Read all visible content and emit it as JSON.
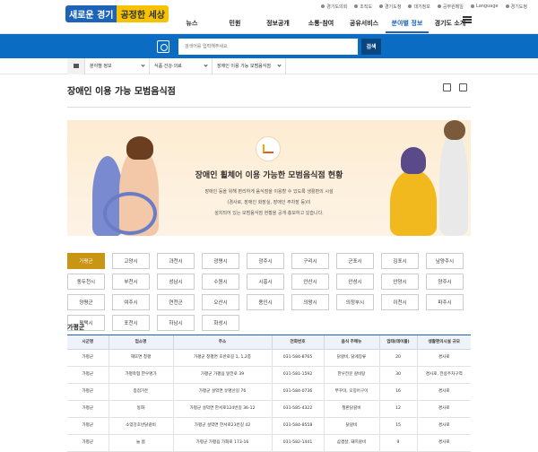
{
  "topbar": {
    "links": [
      "경기도의회",
      "조직도",
      "경기도청",
      "대기정보",
      "공무원메일",
      "Language",
      "경기도청"
    ]
  },
  "logo": {
    "part1": "새로운 경기",
    "part2": "공정한 세상"
  },
  "gnb": {
    "items": [
      "뉴스",
      "민원",
      "정보공개",
      "소통·참여",
      "공유서비스",
      "분야별 정보",
      "경기도 소개"
    ],
    "active_index": 5
  },
  "search": {
    "placeholder": "검색어를 입력해주세요",
    "button": "검색"
  },
  "breadcrumb": {
    "items": [
      "분야별 정보",
      "식품·건강·의료",
      "장애인 이용 가능 모범음식점"
    ]
  },
  "page_title": "장애인 이용 가능 모범음식점",
  "banner": {
    "title": "장애인 휠체어 이용 가능한 모범음식점 현황",
    "lines": [
      "장애인 등을 위해 편리하게 음식점을 이용할 수 있도록 생활편의 시설",
      "(경사로, 장애인 화장실, 장애인 주차장 등)이",
      "설치되어 있는 모범음식점 현황을 공개·홍보하고 있습니다."
    ]
  },
  "regions": [
    "가평군",
    "고양시",
    "과천시",
    "광명시",
    "광주시",
    "구리시",
    "군포시",
    "김포시",
    "남양주시",
    "동두천시",
    "부천시",
    "성남시",
    "수원시",
    "시흥시",
    "안산시",
    "안성시",
    "안양시",
    "양주시",
    "양평군",
    "여주시",
    "연천군",
    "오산시",
    "용인시",
    "의왕시",
    "의정부시",
    "이천시",
    "파주시",
    "평택시",
    "포천시",
    "하남시",
    "화성시"
  ],
  "active_region_index": 0,
  "section_title": "가평군",
  "table": {
    "headers": [
      "시군명",
      "업소명",
      "주소",
      "전화번호",
      "음식 주메뉴",
      "업태(테이블)",
      "생활편의시설 규모"
    ],
    "rows": [
      [
        "가평군",
        "해뜨면 청평",
        "가평군 청평면 호반로길 1, 1,2층",
        "031-584-8765",
        "닭갈비, 닭게장류",
        "20",
        "경사로"
      ],
      [
        "가평군",
        "가평축협 한우명가",
        "가평군 가평읍 달전로 39",
        "031-581-1592",
        "한우전문 갈비탕",
        "30",
        "경사로, 전용주차구역"
      ],
      [
        "가평군",
        "종점가든",
        "가평군 설악면 유명산길 76",
        "031-584-0736",
        "쭈꾸미, 오징어구이",
        "16",
        "경사로"
      ],
      [
        "가평군",
        "동화",
        "가평군 설악면 한서로124번길 36-12",
        "031-585-4322",
        "철판닭갈비",
        "12",
        "경사로"
      ],
      [
        "가평군",
        "소양강호반닭갈비",
        "가평군 설악면 한서로23번길 42",
        "031-584-8558",
        "닭갈비",
        "15",
        "경사로"
      ],
      [
        "가평군",
        "늘 봄",
        "가평군 가평읍 가화로 173-16",
        "031-582-1441",
        "삼겹살, 돼지갈비",
        "9",
        "경사로"
      ]
    ]
  }
}
